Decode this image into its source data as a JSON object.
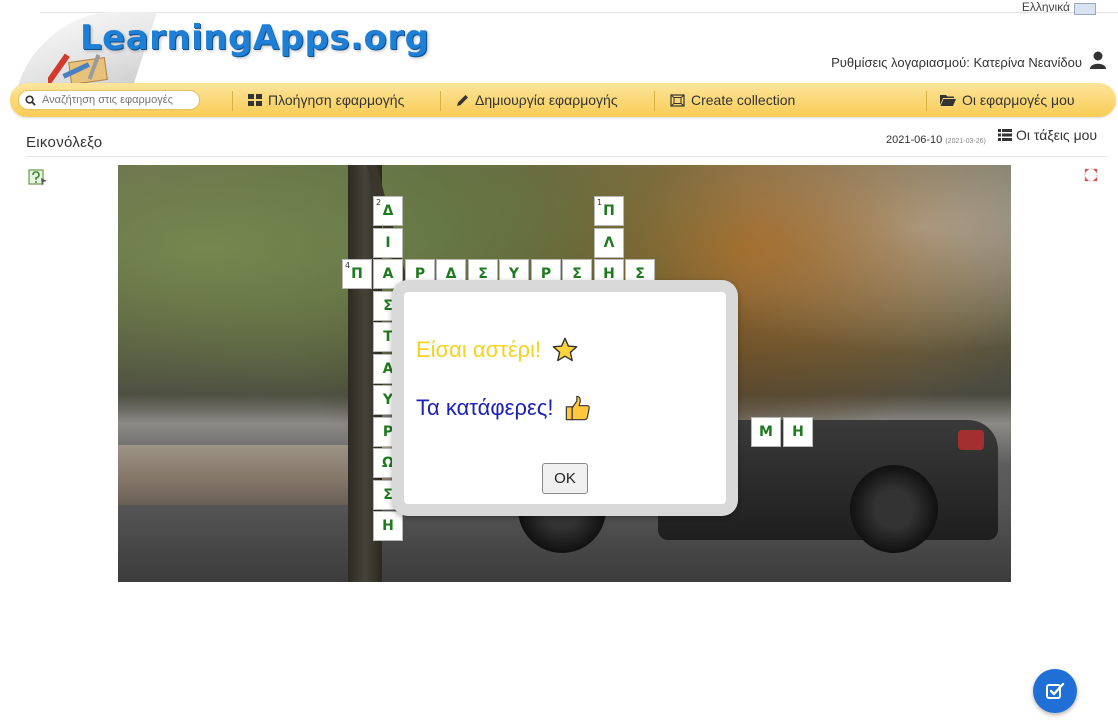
{
  "header": {
    "logo_text": "LearningApps.org",
    "language": "Ελληνικά",
    "account": "Ρυθμίσεις λογαριασμού: Κατερίνα Νεανίδου"
  },
  "nav": {
    "search_placeholder": "Αναζήτηση στις εφαρμογές",
    "browse": "Πλοήγηση εφαρμογής",
    "create": "Δημιουργία εφαρμογής",
    "collection": "Create collection",
    "my_apps": "Οι εφαρμογές μου"
  },
  "sub": {
    "title": "Εικονόλεξο",
    "date": "2021-06-10",
    "date_orig": "(2021-03-26)",
    "my_classes": "Οι τάξεις μου"
  },
  "crossword": {
    "cells": [
      {
        "letter": "Δ",
        "num": "2",
        "col": 0,
        "row": 0
      },
      {
        "letter": "Ι",
        "num": "",
        "col": 0,
        "row": 1
      },
      {
        "letter": "Π",
        "num": "4",
        "col": -1,
        "row": 2
      },
      {
        "letter": "Α",
        "num": "",
        "col": 0,
        "row": 2
      },
      {
        "letter": "Ρ",
        "num": "",
        "col": 1,
        "row": 2
      },
      {
        "letter": "Δ",
        "num": "",
        "col": 2,
        "row": 2
      },
      {
        "letter": "Σ",
        "num": "",
        "col": 3,
        "row": 2
      },
      {
        "letter": "Υ",
        "num": "",
        "col": 4,
        "row": 2
      },
      {
        "letter": "Ρ",
        "num": "",
        "col": 5,
        "row": 2
      },
      {
        "letter": "Σ",
        "num": "",
        "col": 6,
        "row": 2
      },
      {
        "letter": "Η",
        "num": "",
        "col": 7,
        "row": 2
      },
      {
        "letter": "Σ",
        "num": "",
        "col": 8,
        "row": 2
      },
      {
        "letter": "Π",
        "num": "1",
        "col": 7,
        "row": 0
      },
      {
        "letter": "Λ",
        "num": "",
        "col": 7,
        "row": 1
      },
      {
        "letter": "Σ",
        "num": "",
        "col": 0,
        "row": 3
      },
      {
        "letter": "Τ",
        "num": "",
        "col": 0,
        "row": 4
      },
      {
        "letter": "Α",
        "num": "",
        "col": 0,
        "row": 5
      },
      {
        "letter": "Υ",
        "num": "",
        "col": 0,
        "row": 6
      },
      {
        "letter": "Ρ",
        "num": "",
        "col": 0,
        "row": 7
      },
      {
        "letter": "Ω",
        "num": "",
        "col": 0,
        "row": 8
      },
      {
        "letter": "Σ",
        "num": "",
        "col": 0,
        "row": 9
      },
      {
        "letter": "Η",
        "num": "",
        "col": 0,
        "row": 10
      },
      {
        "letter": "Μ",
        "num": "",
        "col": 12,
        "row": 7
      },
      {
        "letter": "Η",
        "num": "",
        "col": 13,
        "row": 7
      }
    ]
  },
  "dialog": {
    "line1": "Είσαι αστέρι!",
    "line2": "Τα κατάφερες!",
    "ok": "OK"
  },
  "icons": {
    "star": "star-icon",
    "thumbs_up": "thumbs-up-icon"
  },
  "colors": {
    "nav_bg": "#f8cc55",
    "logo": "#1e7fd6",
    "star_text": "#f5d21e",
    "success_text": "#1c22b8",
    "cell_text": "#1f7a1f",
    "fab": "#1f6fd6"
  }
}
